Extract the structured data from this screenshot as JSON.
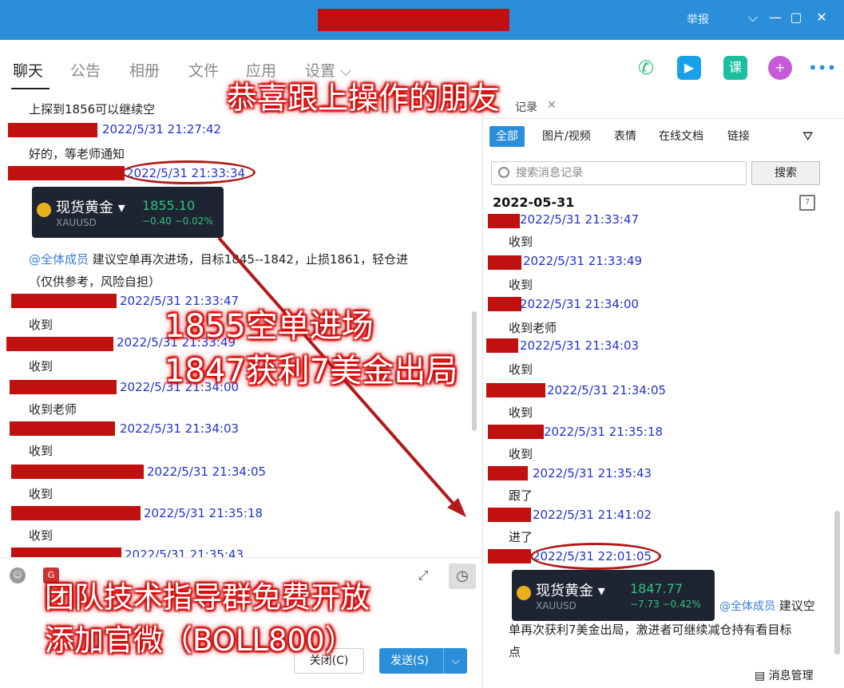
{
  "window": {
    "report": "举报",
    "controls": [
      "⌵",
      "—",
      "▢",
      "✕"
    ]
  },
  "tabs": [
    "聊天",
    "公告",
    "相册",
    "文件",
    "应用",
    "设置 ⌵"
  ],
  "left_messages": [
    {
      "text": "上探到1856可以继续空"
    },
    {
      "ts": "2022/5/31 21:27:42"
    },
    {
      "text": "好的，等老师通知"
    },
    {
      "ts": "2022/5/31 21:33:34"
    },
    {
      "ts": "2022/5/31 21:33:47",
      "text": "收到"
    },
    {
      "ts": "2022/5/31 21:33:49",
      "text": "收到"
    },
    {
      "ts": "2022/5/31 21:34:00",
      "text": "收到老师"
    },
    {
      "ts": "2022/5/31 21:34:03",
      "text": "收到"
    },
    {
      "ts": "2022/5/31 21:34:05",
      "text": "收到"
    },
    {
      "ts": "2022/5/31 21:35:18",
      "text": "收到"
    },
    {
      "ts": "2022/5/31 21:35:43"
    }
  ],
  "left_card": {
    "name": "现货黄金 ▾",
    "symbol": "XAUUSD",
    "price": "1855.10",
    "change": "−0.40   −0.02%"
  },
  "left_mention": {
    "at": "@全体成员",
    "text": " 建议空单再次进场，目标1845--1842，止损1861，轻仓进",
    "text2": "（仅供参考，风险自担）"
  },
  "buttons": {
    "close": "关闭(C)",
    "send": "发送(S)",
    "send_dd": "⌵"
  },
  "right": {
    "tab": "记录",
    "filters": [
      "全部",
      "图片/视频",
      "表情",
      "在线文档",
      "链接"
    ],
    "search_placeholder": "搜索消息记录",
    "search_btn": "搜索",
    "date": "2022-05-31",
    "messages": [
      {
        "ts": "2022/5/31 21:33:47",
        "text": "收到"
      },
      {
        "ts": "2022/5/31 21:33:49",
        "text": "收到"
      },
      {
        "ts": "2022/5/31 21:34:00",
        "text": "收到老师"
      },
      {
        "ts": "2022/5/31 21:34:03",
        "text": "收到"
      },
      {
        "ts": "2022/5/31 21:34:05",
        "text": "收到"
      },
      {
        "ts": "2022/5/31 21:35:18",
        "text": "收到"
      },
      {
        "ts": "2022/5/31 21:35:43",
        "text": "跟了"
      },
      {
        "ts": "2022/5/31 21:41:02",
        "text": "进了"
      },
      {
        "ts": "2022/5/31 22:01:05"
      }
    ],
    "card": {
      "name": "现货黄金 ▾",
      "symbol": "XAUUSD",
      "price": "1847.77",
      "change": "−7.73   −0.42%"
    },
    "mention": "@全体成员",
    "mention_text": " 建议空",
    "mention_text2": "单再次获利7美金出局，激进者可继续减仓持有看目标",
    "mention_text3": "点",
    "footer": "消息管理"
  },
  "overlays": {
    "top": "恭喜跟上操作的朋友",
    "mid1": "1855空单进场",
    "mid2": "1847获利7美金出局",
    "bot1": "团队技术指导群免费开放",
    "bot2": "添加官微（BOLL800）"
  }
}
